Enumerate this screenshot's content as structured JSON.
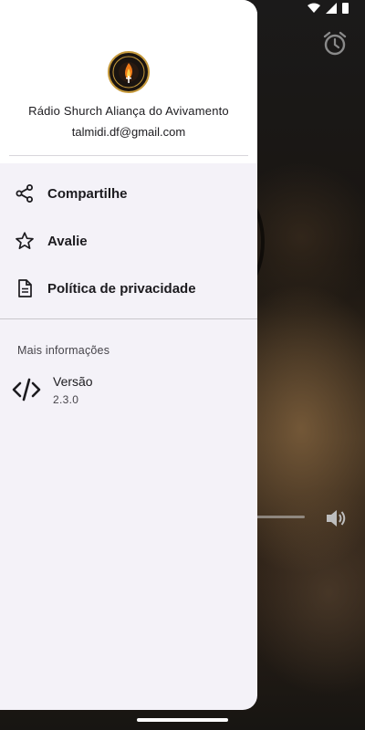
{
  "drawer": {
    "header": {
      "app_name": "Rádio Shurch Aliança do Avivamento",
      "email": "talmidi.df@gmail.com",
      "logo_icon": "church-flame-logo"
    },
    "menu": [
      {
        "label": "Compartilhe",
        "icon": "share-icon"
      },
      {
        "label": "Avalie",
        "icon": "star-outline-icon"
      },
      {
        "label": "Política de privacidade",
        "icon": "document-icon"
      }
    ],
    "more_info": {
      "title": "Mais informações",
      "version_label": "Versão",
      "version_value": "2.3.0",
      "icon": "code-icon"
    }
  },
  "colors": {
    "drawer_background": "#f4f2f8",
    "header_background": "#ffffff",
    "text_primary": "#1c1b1f",
    "logo_accent": "#c69a3c"
  }
}
